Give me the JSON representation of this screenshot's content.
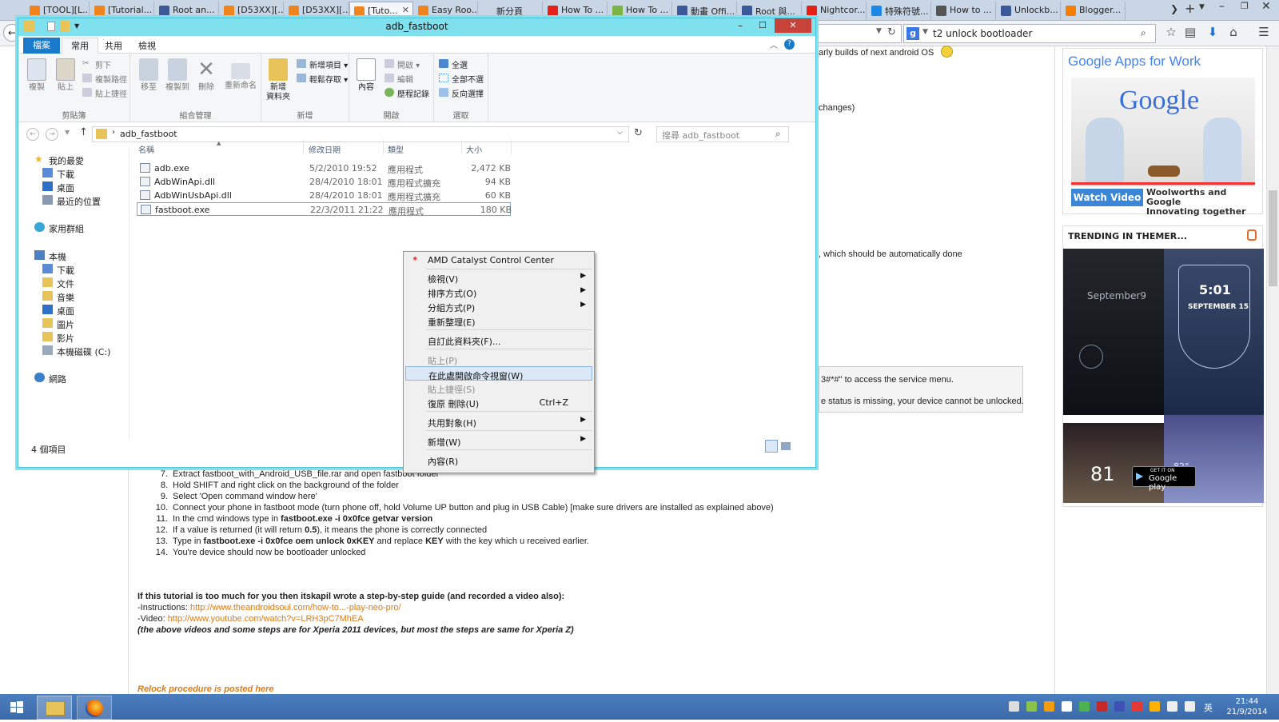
{
  "browser": {
    "tabs": [
      {
        "label": "[TOOL][L...",
        "icon": "xda-icon",
        "active": false
      },
      {
        "label": "[Tutorial...",
        "icon": "xda-icon",
        "active": false
      },
      {
        "label": "Root an...",
        "icon": "page-icon",
        "active": false
      },
      {
        "label": "[D53XX][...",
        "icon": "xda-icon",
        "active": false
      },
      {
        "label": "[D53XX][...",
        "icon": "xda-icon",
        "active": false
      },
      {
        "label": "[Tuto...",
        "icon": "xda-icon",
        "active": true
      },
      {
        "label": "Easy Roo...",
        "icon": "xda-icon",
        "active": false
      },
      {
        "label": "新分頁",
        "icon": "none",
        "active": false
      },
      {
        "label": "How To ...",
        "icon": "youtube-icon",
        "active": false
      },
      {
        "label": "How To ...",
        "icon": "android-icon",
        "active": false
      },
      {
        "label": "動畫 Offi...",
        "icon": "page-icon",
        "active": false
      },
      {
        "label": "Root 與...",
        "icon": "page-icon",
        "active": false
      },
      {
        "label": "Nightcor...",
        "icon": "youtube-icon",
        "active": false
      },
      {
        "label": "特殊符號...",
        "icon": "star-icon",
        "active": false
      },
      {
        "label": "How to ...",
        "icon": "lock-icon",
        "active": false
      },
      {
        "label": "Unlockb...",
        "icon": "page-icon",
        "active": false
      },
      {
        "label": "Blogger...",
        "icon": "blogger-icon",
        "active": false
      }
    ],
    "search_value": "t2 unlock bootloader",
    "colors": {
      "tabbar": "#c9d6e6",
      "link": "#e07a16"
    }
  },
  "page": {
    "fragments": [
      {
        "text": "arly builds of next android OS",
        "emoji": "smiley"
      },
      {
        "text": "changes)"
      },
      {
        "text": "which should be automatically done"
      },
      {
        "text": "3#*#\" to access the service menu."
      },
      {
        "text": "e status is missing, your device cannot be unlocked."
      }
    ],
    "steps": [
      {
        "num": "7.",
        "text": "Extract fastboot_with_Android_USB_file.rar and open fastboot folder"
      },
      {
        "num": "8.",
        "text": "Hold SHIFT and right click on the background of the folder"
      },
      {
        "num": "9.",
        "text": "Select 'Open command window here'"
      },
      {
        "num": "10.",
        "text": "Connect your phone in fastboot mode (turn phone off, hold Volume UP button and plug in USB Cable) [make sure drivers are installed as explained above)"
      },
      {
        "num": "11.",
        "pre": "In the cmd windows type in ",
        "bold": "fastboot.exe -i 0x0fce getvar version",
        "post": ""
      },
      {
        "num": "12.",
        "pre": "If a value is returned (it will return ",
        "bold": "0.5",
        "post": "), it means the phone is correctly connected"
      },
      {
        "num": "13.",
        "pre": "Type in ",
        "bold": "fastboot.exe -i 0x0fce oem unlock 0xKEY",
        "post": " and replace ",
        "bold2": "KEY",
        "post2": " with the key which u received earlier."
      },
      {
        "num": "14.",
        "text": "You're device should now be bootloader unlocked"
      }
    ],
    "tutorial_heading": "If this tutorial is too much for you then itskapil wrote a step-by-step guide (and recorded a video also):",
    "instructions_label": "-Instructions: ",
    "instructions_link": "http://www.theandroidsoul.com/how-to...-play-neo-pro/",
    "video_label": "-Video: ",
    "video_link": "http://www.youtube.com/watch?v=LRH3pC7MhEA",
    "note": "(the above videos and some steps are for Xperia 2011 devices, but most the steps are same for Xperia Z)",
    "relock": "Relock procedure is posted here"
  },
  "sidebar": {
    "ad_title": "Google Apps for Work",
    "ad_logo": "Google",
    "ad_button": "Watch Video",
    "ad_caption_line1": "Woolworths and Google",
    "ad_caption_line2": "Innovating together",
    "trending_title": "TRENDING IN THEMER...",
    "theme1_date": "September9",
    "theme2_time": "5:01",
    "theme2_date": "SEPTEMBER 15",
    "theme3_temp": "81",
    "theme3_small": "82°",
    "play_badge_top": "GET IT ON",
    "play_badge_name": "Google play"
  },
  "explorer": {
    "title": "adb_fastboot",
    "ribbon_tabs": [
      "檔案",
      "常用",
      "共用",
      "檢視"
    ],
    "groups": {
      "clipboard": {
        "label": "剪貼簿",
        "copy": "複製",
        "paste": "貼上",
        "cut": "剪下",
        "copy_path": "複製路徑",
        "paste_shortcut": "貼上捷徑"
      },
      "organize": {
        "label": "組合管理",
        "move": "移至",
        "copy_to": "複製到",
        "delete": "刪除",
        "rename": "重新命名"
      },
      "new": {
        "label": "新增",
        "new_folder_1": "新增",
        "new_folder_2": "資料夾",
        "new_item": "新增項目",
        "easy_access": "輕鬆存取"
      },
      "open": {
        "label": "開啟",
        "properties": "內容",
        "open": "開啟",
        "edit": "編輯",
        "history": "歷程記錄"
      },
      "select": {
        "label": "選取",
        "all": "全選",
        "none": "全部不選",
        "invert": "反向選擇"
      }
    },
    "path": "adb_fastboot",
    "search_placeholder": "搜尋 adb_fastboot",
    "nav": {
      "favorites": "我的最愛",
      "fav_items": [
        "下載",
        "桌面",
        "最近的位置"
      ],
      "homegroup": "家用群組",
      "this_pc": "本機",
      "pc_items": [
        "下載",
        "文件",
        "音樂",
        "桌面",
        "圖片",
        "影片",
        "本機磁碟 (C:)"
      ],
      "network": "網路"
    },
    "columns": {
      "name": "名稱",
      "modified": "修改日期",
      "type": "類型",
      "size": "大小"
    },
    "files": [
      {
        "name": "adb.exe",
        "modified": "5/2/2010 19:52",
        "type": "應用程式",
        "size": "2,472 KB"
      },
      {
        "name": "AdbWinApi.dll",
        "modified": "28/4/2010 18:01",
        "type": "應用程式擴充",
        "size": "94 KB"
      },
      {
        "name": "AdbWinUsbApi.dll",
        "modified": "28/4/2010 18:01",
        "type": "應用程式擴充",
        "size": "60 KB"
      },
      {
        "name": "fastboot.exe",
        "modified": "22/3/2011 21:22",
        "type": "應用程式",
        "size": "180 KB"
      }
    ],
    "status": "4 個項目",
    "colors": {
      "frame": "#7fe0ee",
      "file_tab": "#1979ca",
      "close": "#c7433a"
    }
  },
  "context_menu": {
    "header": "AMD Catalyst Control Center",
    "items": {
      "view": "檢視(V)",
      "sort": "排序方式(O)",
      "group": "分組方式(P)",
      "refresh": "重新整理(E)",
      "customize": "自訂此資料夾(F)...",
      "paste": "貼上(P)",
      "open_cmd": "在此處開啟命令視窗(W)",
      "paste_shortcut": "貼上捷徑(S)",
      "undo": "復原 刪除(U)",
      "undo_shortcut": "Ctrl+Z",
      "share": "共用對象(H)",
      "new": "新增(W)",
      "properties": "內容(R)"
    }
  },
  "taskbar": {
    "time": "21:44",
    "date": "21/9/2014",
    "ime": "英",
    "apps": [
      "start-icon",
      "explorer-icon",
      "firefox-icon"
    ]
  }
}
